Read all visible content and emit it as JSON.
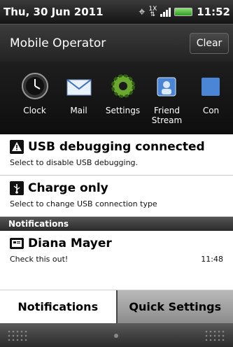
{
  "statusbar": {
    "date": "Thu, 30 Jun 2011",
    "data_indicator": "1X",
    "time": "11:52"
  },
  "operator": {
    "name": "Mobile Operator",
    "clear_label": "Clear"
  },
  "apps": [
    {
      "label": "Clock",
      "icon": "clock-icon"
    },
    {
      "label": "Mail",
      "icon": "mail-icon"
    },
    {
      "label": "Settings",
      "icon": "settings-icon"
    },
    {
      "label": "Friend Stream",
      "icon": "friend-stream-icon"
    },
    {
      "label": "Con",
      "icon": "contacts-icon"
    }
  ],
  "notifications_top": [
    {
      "title": "USB debugging connected",
      "subtitle": "Select to disable USB debugging.",
      "icon": "warning-icon"
    },
    {
      "title": "Charge only",
      "subtitle": "Select to change USB connection type",
      "icon": "usb-icon"
    }
  ],
  "section_header": "Notifications",
  "notification_message": {
    "title": "Diana Mayer",
    "subtitle": "Check this out!",
    "time": "11:48",
    "icon": "message-icon"
  },
  "tabs": {
    "notifications": "Notifications",
    "quick_settings": "Quick Settings"
  }
}
